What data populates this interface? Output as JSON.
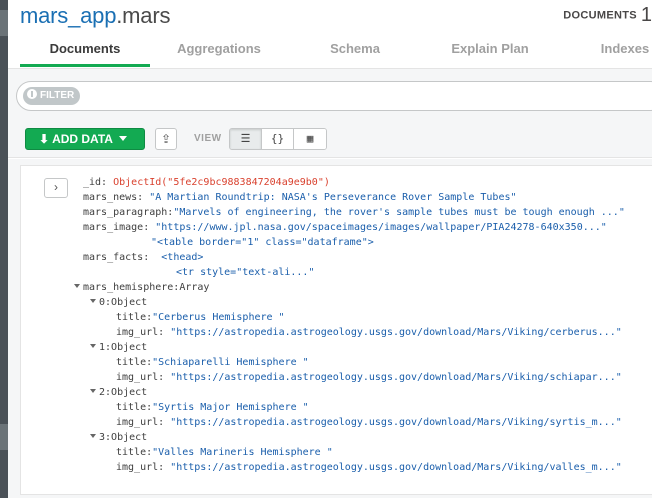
{
  "namespace": {
    "db": "mars_app",
    "dot": ".",
    "collection": "mars"
  },
  "doc_count": {
    "label": "DOCUMENTS",
    "value": "1"
  },
  "tabs": [
    {
      "label": "Documents",
      "active": true
    },
    {
      "label": "Aggregations",
      "active": false
    },
    {
      "label": "Schema",
      "active": false
    },
    {
      "label": "Explain Plan",
      "active": false
    },
    {
      "label": "Indexes",
      "active": false
    }
  ],
  "filter": {
    "label": "FILTER",
    "icon": "info-icon"
  },
  "toolbar": {
    "add_data_label": "ADD DATA",
    "export_icon": "export-icon",
    "view_label": "VIEW",
    "view_modes": [
      {
        "icon": "list-view-icon",
        "glyph": "☰"
      },
      {
        "icon": "json-view-icon",
        "glyph": "{}"
      },
      {
        "icon": "table-view-icon",
        "glyph": "▦"
      }
    ]
  },
  "document": {
    "expand_glyph": "›",
    "id_key": "_id:",
    "id_value": "ObjectId(\"5fe2c9bc9883847204a9e9b0\")",
    "news_key": "mars_news:",
    "news_value": "\"A Martian Roundtrip: NASA's Perseverance Rover Sample Tubes\"",
    "paragraph_key": "mars_paragraph:",
    "paragraph_value": "\"Marvels of engineering, the rover's sample tubes must be tough enough ...\"",
    "image_key": "mars_image:",
    "image_value": "\"https://www.jpl.nasa.gov/spaceimages/images/wallpaper/PIA24278-640x350...\"",
    "table_line": "\"<table border=\"1\" class=\"dataframe\">",
    "facts_key": "mars_facts:",
    "facts_line1": "<thead>",
    "facts_line2": "<tr style=\"text-ali...\"",
    "hemi_key": "mars_hemisphere:",
    "hemi_type": "Array",
    "hemispheres": [
      {
        "index": "0:",
        "type": "Object",
        "title_key": "title:",
        "title": "\"Cerberus Hemisphere \"",
        "url_key": "img_url:",
        "url": "\"https://astropedia.astrogeology.usgs.gov/download/Mars/Viking/cerberus...\""
      },
      {
        "index": "1:",
        "type": "Object",
        "title_key": "title:",
        "title": "\"Schiaparelli Hemisphere \"",
        "url_key": "img_url:",
        "url": "\"https://astropedia.astrogeology.usgs.gov/download/Mars/Viking/schiapar...\""
      },
      {
        "index": "2:",
        "type": "Object",
        "title_key": "title:",
        "title": "\"Syrtis Major Hemisphere \"",
        "url_key": "img_url:",
        "url": "\"https://astropedia.astrogeology.usgs.gov/download/Mars/Viking/syrtis_m...\""
      },
      {
        "index": "3:",
        "type": "Object",
        "title_key": "title:",
        "title": "\"Valles Marineris Hemisphere \"",
        "url_key": "img_url:",
        "url": "\"https://astropedia.astrogeology.usgs.gov/download/Mars/Viking/valles_m...\""
      }
    ]
  },
  "colors": {
    "accent_green": "#13aa52",
    "string_blue": "#1a5eab",
    "objectid_red": "#d9412e",
    "namespace_blue": "#1a6fb3"
  }
}
